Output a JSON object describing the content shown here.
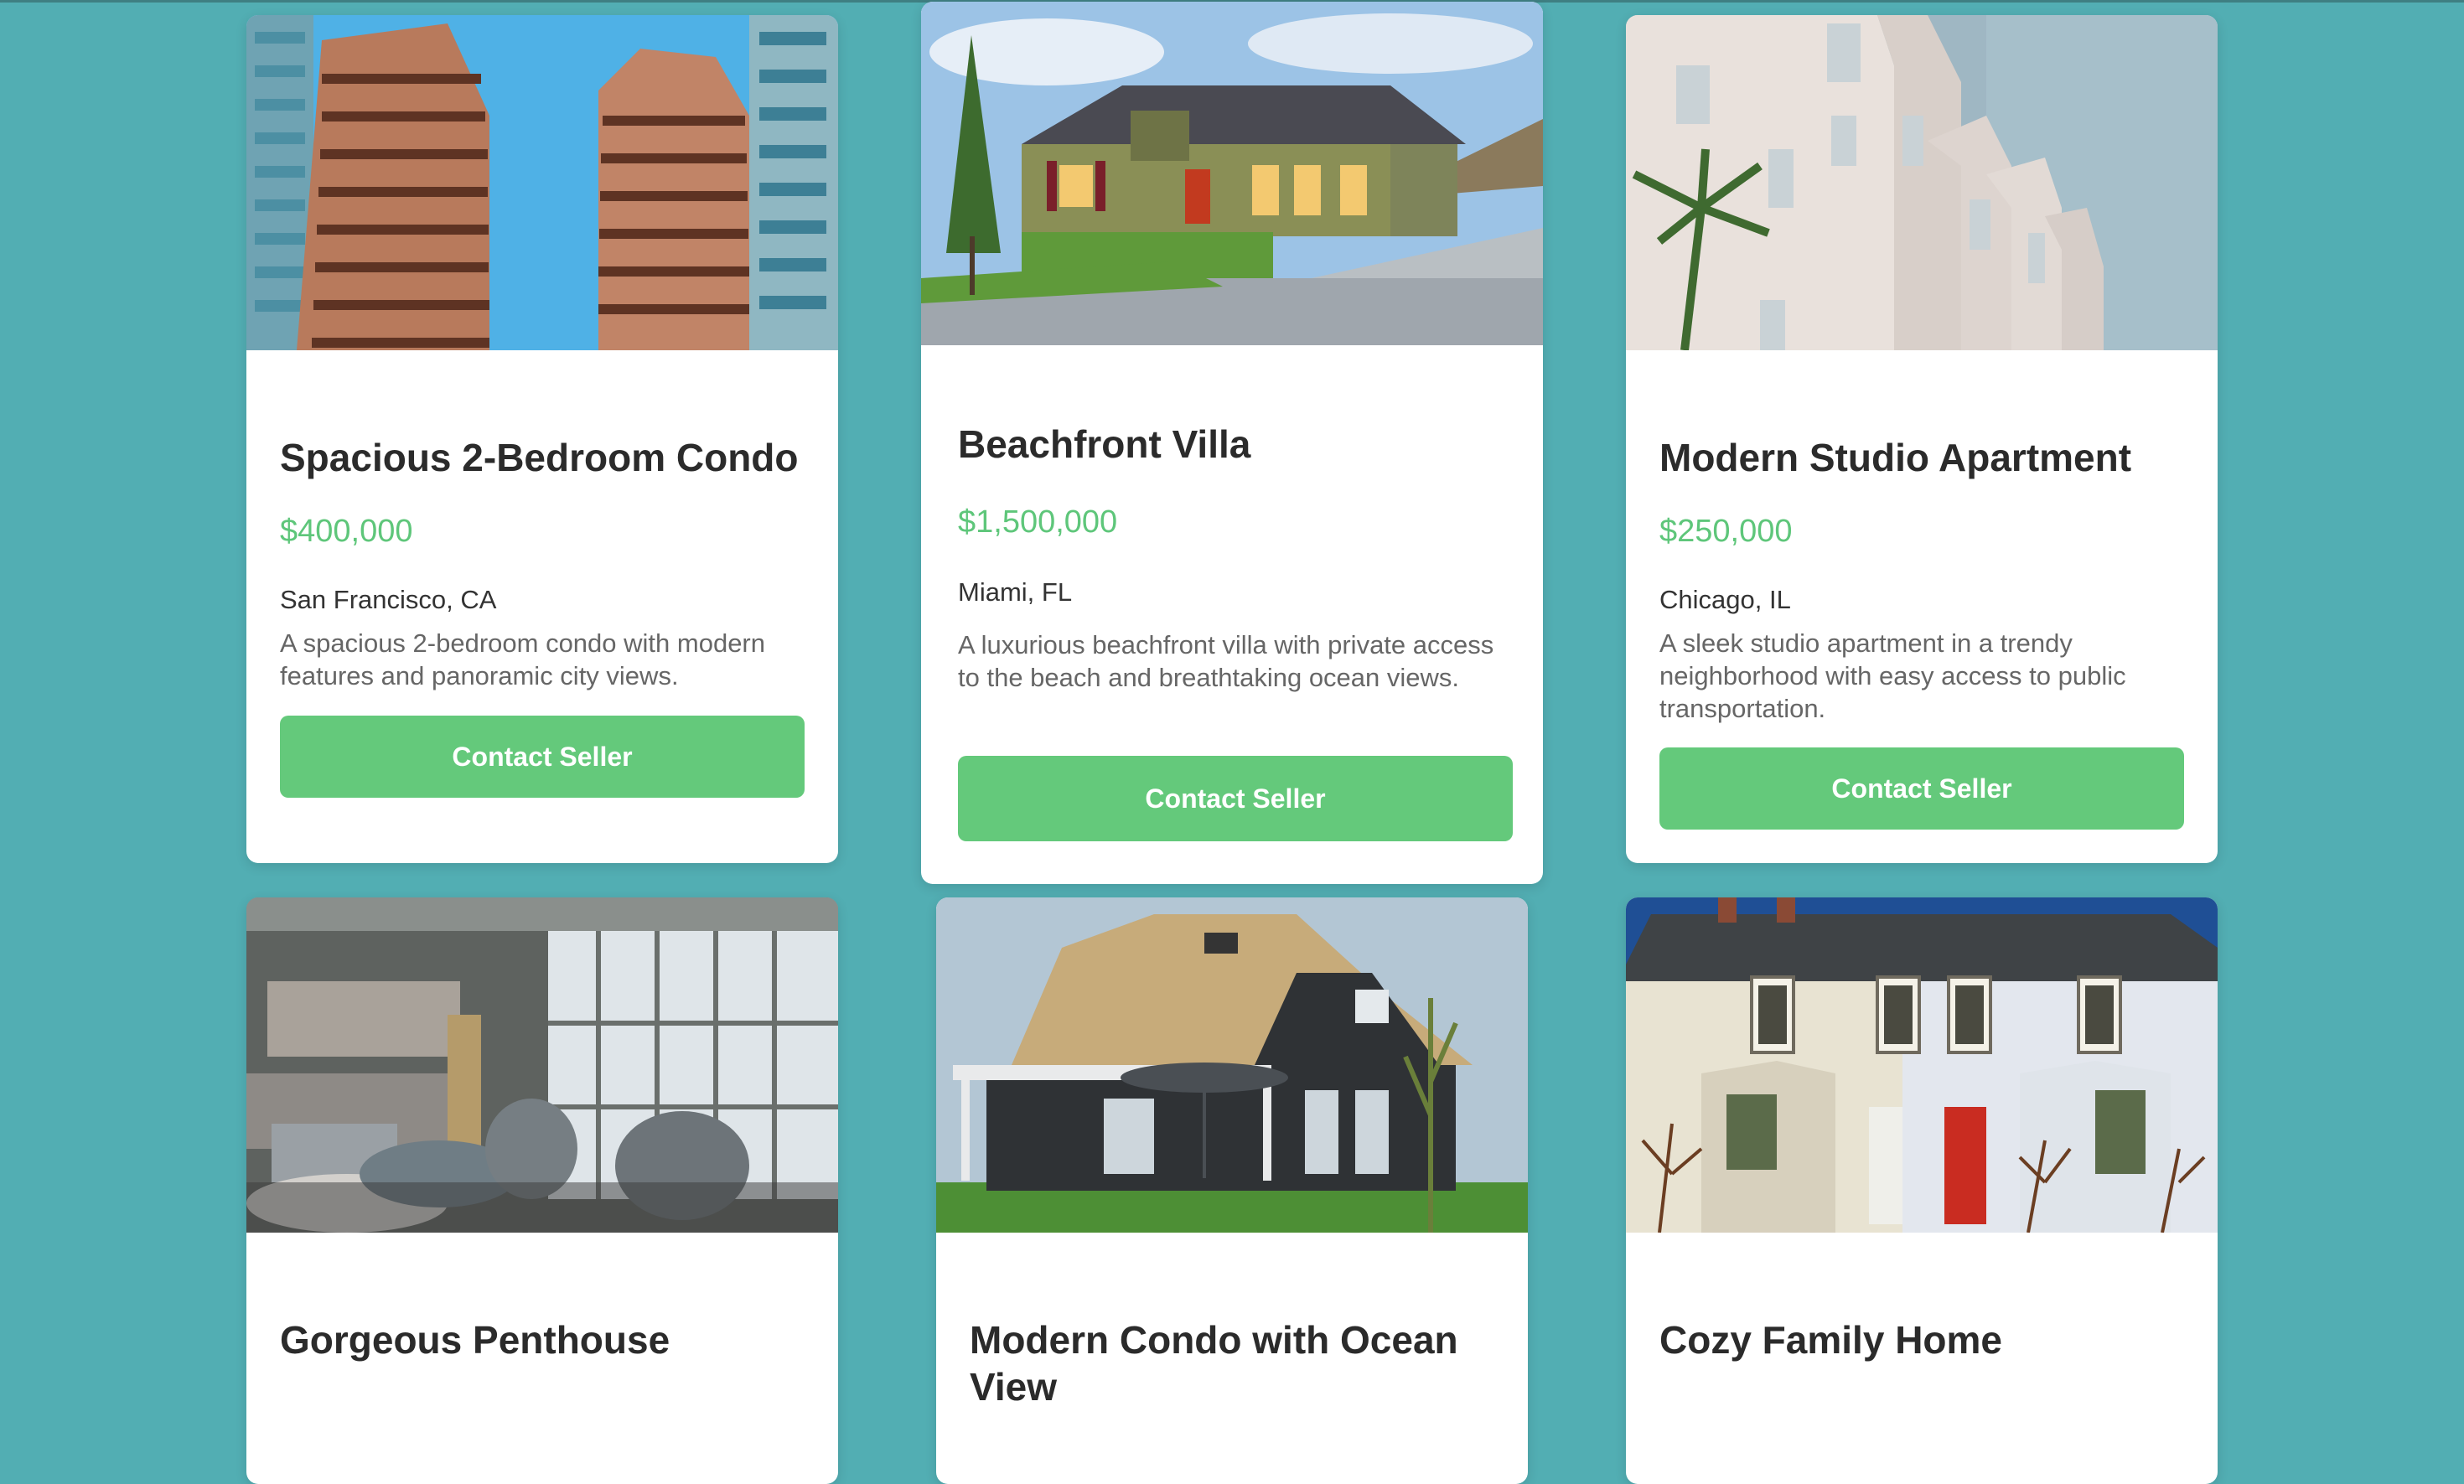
{
  "listings": [
    {
      "title": "Spacious 2-Bedroom Condo",
      "price": "$400,000",
      "location": "San Francisco, CA",
      "description": "A spacious 2-bedroom condo with modern features and panoramic city views.",
      "button": "Contact Seller",
      "image": "twin-high-rise-towers-photo"
    },
    {
      "title": "Beachfront Villa",
      "price": "$1,500,000",
      "location": "Miami, FL",
      "description": "A luxurious beachfront villa with private access to the beach and breathtaking ocean views.",
      "button": "Contact Seller",
      "image": "green-house-with-lawn-photo"
    },
    {
      "title": "Modern Studio Apartment",
      "price": "$250,000",
      "location": "Chicago, IL",
      "description": "A sleek studio apartment in a trendy neighborhood with easy access to public transportation.",
      "button": "Contact Seller",
      "image": "white-apartment-facade-photo"
    },
    {
      "title": "Gorgeous Penthouse",
      "image": "penthouse-living-room-photo"
    },
    {
      "title": "Modern Condo with Ocean View",
      "image": "thatched-roof-house-photo"
    },
    {
      "title": "Cozy Family Home",
      "image": "terraced-brick-houses-photo"
    }
  ],
  "colors": {
    "background": "#52aeb3",
    "card": "#ffffff",
    "price": "#5ec67a",
    "button": "#64c97b",
    "title": "#2b2b2b",
    "text": "#333333",
    "muted": "#666666"
  }
}
